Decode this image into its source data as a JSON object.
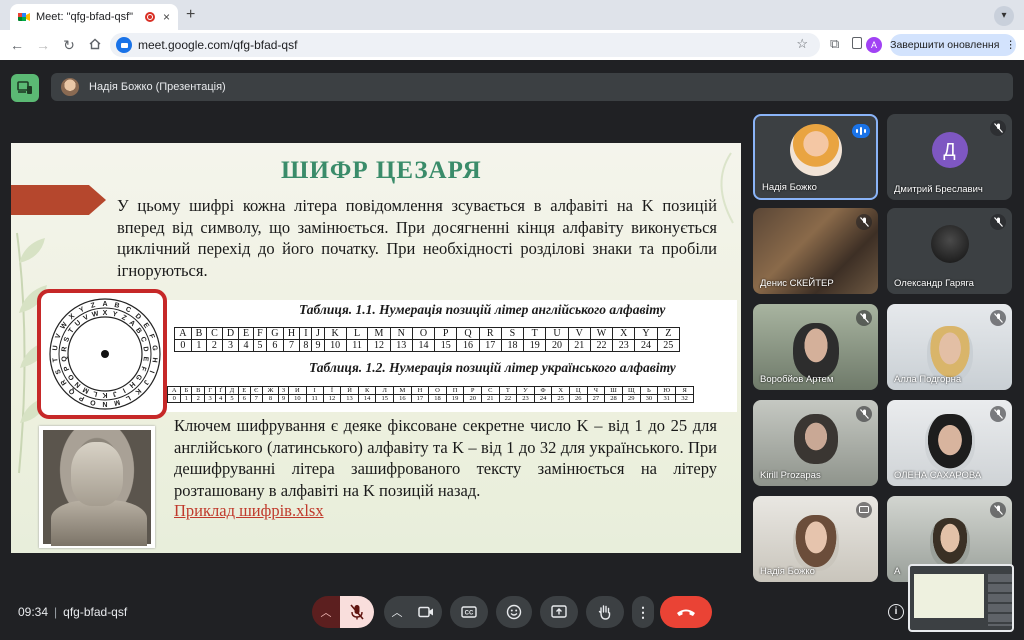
{
  "browser": {
    "tab_title": "Meet: \"qfg-bfad-qsf\"",
    "tab_close": "×",
    "new_tab": "+",
    "url": "meet.google.com/qfg-bfad-qsf",
    "profile_letter": "A",
    "update_button": "Завершити оновлення",
    "more": "⋮"
  },
  "meet": {
    "presenter_label": "Надія Божко (Презентація)",
    "meeting_time": "09:34",
    "meeting_code": "qfg-bfad-qsf"
  },
  "slide": {
    "title": "ШИФР ЦЕЗАРЯ",
    "paragraph1": "У цьому шифрі кожна літера повідомлення зсувається в алфавіті на K позицій вперед від символу, що замінюється. При досягненні кінця алфавіту виконується циклічний перехід до його початку. При необхідності розділові знаки та пробіли ігноруються.",
    "table1_caption": "Таблиця. 1.1. Нумерація позицій літер англійського алфавіту",
    "table2_caption": "Таблиця. 1.2. Нумерація позицій літер українського алфавіту",
    "english_letters": [
      "A",
      "B",
      "C",
      "D",
      "E",
      "F",
      "G",
      "H",
      "I",
      "J",
      "K",
      "L",
      "M",
      "N",
      "O",
      "P",
      "Q",
      "R",
      "S",
      "T",
      "U",
      "V",
      "W",
      "X",
      "Y",
      "Z"
    ],
    "english_numbers": [
      "0",
      "1",
      "2",
      "3",
      "4",
      "5",
      "6",
      "7",
      "8",
      "9",
      "10",
      "11",
      "12",
      "13",
      "14",
      "15",
      "16",
      "17",
      "18",
      "19",
      "20",
      "21",
      "22",
      "23",
      "24",
      "25"
    ],
    "ukrainian_letters": [
      "А",
      "Б",
      "В",
      "Г",
      "Ґ",
      "Д",
      "Е",
      "Є",
      "Ж",
      "З",
      "И",
      "І",
      "Ї",
      "Й",
      "К",
      "Л",
      "М",
      "Н",
      "О",
      "П",
      "Р",
      "С",
      "Т",
      "У",
      "Ф",
      "Х",
      "Ц",
      "Ч",
      "Ш",
      "Щ",
      "Ь",
      "Ю",
      "Я"
    ],
    "ukrainian_numbers": [
      "0",
      "1",
      "2",
      "3",
      "4",
      "5",
      "6",
      "7",
      "8",
      "9",
      "10",
      "11",
      "12",
      "13",
      "14",
      "15",
      "16",
      "17",
      "18",
      "19",
      "20",
      "21",
      "22",
      "23",
      "24",
      "25",
      "26",
      "27",
      "28",
      "29",
      "30",
      "31",
      "32"
    ],
    "paragraph2": "Ключем шифрування є деяке фіксоване секретне число K – від 1 до 25 для англійського (латинського) алфавіту та K – від 1 до 32 для українського. При дешифруванні літера зашифрованого тексту замінюється на літеру розташовану в алфавіті на K позицій назад.",
    "link": "Приклад шифрів.xlsx"
  },
  "participants": [
    {
      "name": "Надія Божко",
      "state": "speaking"
    },
    {
      "name": "Дмитрий Бреславич",
      "initial": "Д",
      "state": "muted"
    },
    {
      "name": "Денис СКЕЙТЕР",
      "state": "muted"
    },
    {
      "name": "Олександр Гаряга",
      "state": "muted"
    },
    {
      "name": "Воробйов Артем",
      "state": "muted"
    },
    {
      "name": "Алла Подгорна",
      "state": "muted"
    },
    {
      "name": "Kirill Prozapas",
      "state": "muted"
    },
    {
      "name": "ОЛЕНА САХАРОВА",
      "state": "muted"
    },
    {
      "name": "Надія Божко",
      "state": "presenting"
    },
    {
      "name": "А",
      "state": "muted"
    }
  ],
  "colors": {
    "accent_green": "#5bb974",
    "hangup_red": "#ea4335",
    "slide_title": "#3a8c6a",
    "link_red": "#c0392b",
    "speaking_blue": "#1a73e8"
  },
  "icons": [
    "google-meet-favicon",
    "record-icon",
    "back-icon",
    "forward-icon",
    "reload-icon",
    "home-icon",
    "site-info-icon",
    "bookmark-star-icon",
    "extensions-icon",
    "mic-off-icon",
    "camera-icon",
    "captions-icon",
    "emoji-icon",
    "present-icon",
    "raise-hand-icon",
    "more-options-icon",
    "hangup-icon",
    "info-icon"
  ]
}
